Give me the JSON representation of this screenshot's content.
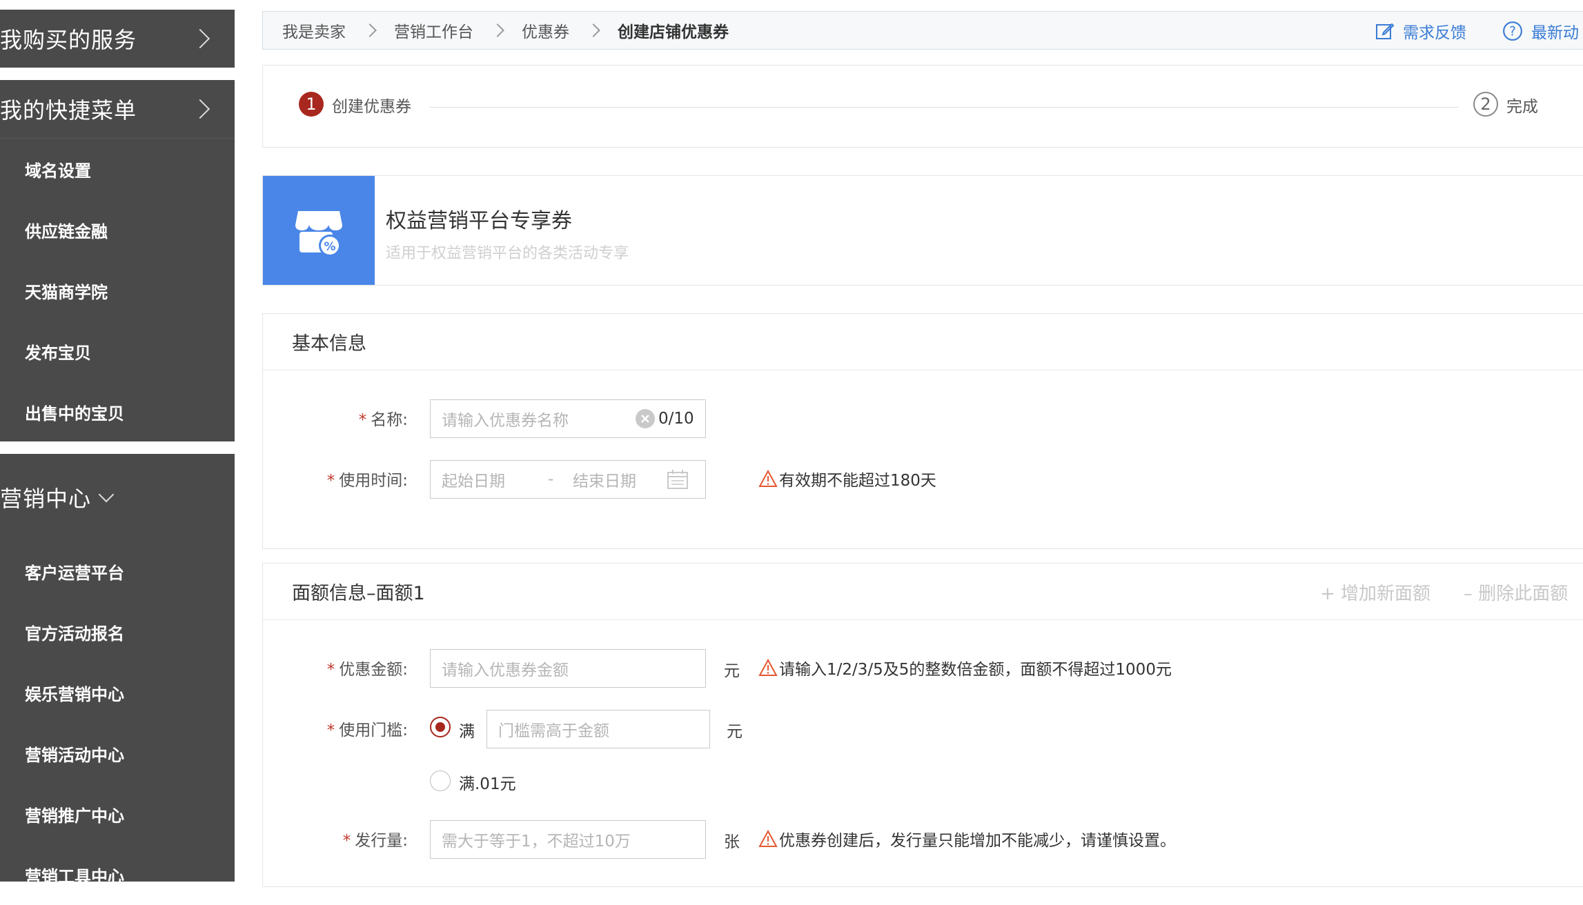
{
  "sidebar": {
    "purchased_services": "我购买的服务",
    "shortcut_menu": "我的快捷菜单",
    "shortcut_items": [
      "域名设置",
      "供应链金融",
      "天猫商学院",
      "发布宝贝",
      "出售中的宝贝"
    ],
    "marketing_center": "营销中心",
    "marketing_items": [
      "客户运营平台",
      "官方活动报名",
      "娱乐营销中心",
      "营销活动中心",
      "营销推广中心",
      "营销工具中心"
    ]
  },
  "breadcrumb": {
    "items": [
      "我是卖家",
      "营销工作台",
      "优惠券",
      "创建店铺优惠券"
    ],
    "feedback": "需求反馈",
    "latest": "最新动"
  },
  "steps": {
    "step1_num": "1",
    "step1_label": "创建优惠券",
    "step2_num": "2",
    "step2_label": "完成"
  },
  "banner": {
    "title": "权益营销平台专享券",
    "desc": "适用于权益营销平台的各类活动专享"
  },
  "basic_info": {
    "title": "基本信息",
    "name_label": "名称:",
    "name_placeholder": "请输入优惠券名称",
    "name_count": "0/10",
    "time_label": "使用时间:",
    "start_placeholder": "起始日期",
    "date_sep": "-",
    "end_placeholder": "结束日期",
    "time_warning": "有效期不能超过180天"
  },
  "amount_info": {
    "title": "面额信息–面额1",
    "add_action": "+ 增加新面额",
    "delete_action": "– 删除此面额",
    "amount_label": "优惠金额:",
    "amount_placeholder": "请输入优惠券金额",
    "amount_unit": "元",
    "amount_warning": "请输入1/2/3/5及5的整数倍金额，面额不得超过1000元",
    "threshold_label": "使用门槛:",
    "threshold_option1": "满",
    "threshold_placeholder": "门槛需高于金额",
    "threshold_unit": "元",
    "threshold_option2": "满.01元",
    "issue_label": "发行量:",
    "issue_placeholder": "需大于等于1，不超过10万",
    "issue_unit": "张",
    "issue_warning": "优惠券创建后，发行量只能增加不能减少，请谨慎设置。"
  },
  "colors": {
    "sidebar_bg": "#4a4a4a",
    "accent_red": "#a8271e",
    "link_blue": "#3a7bd5",
    "banner_blue": "#4a86e8",
    "warning_orange": "#e4572e"
  }
}
